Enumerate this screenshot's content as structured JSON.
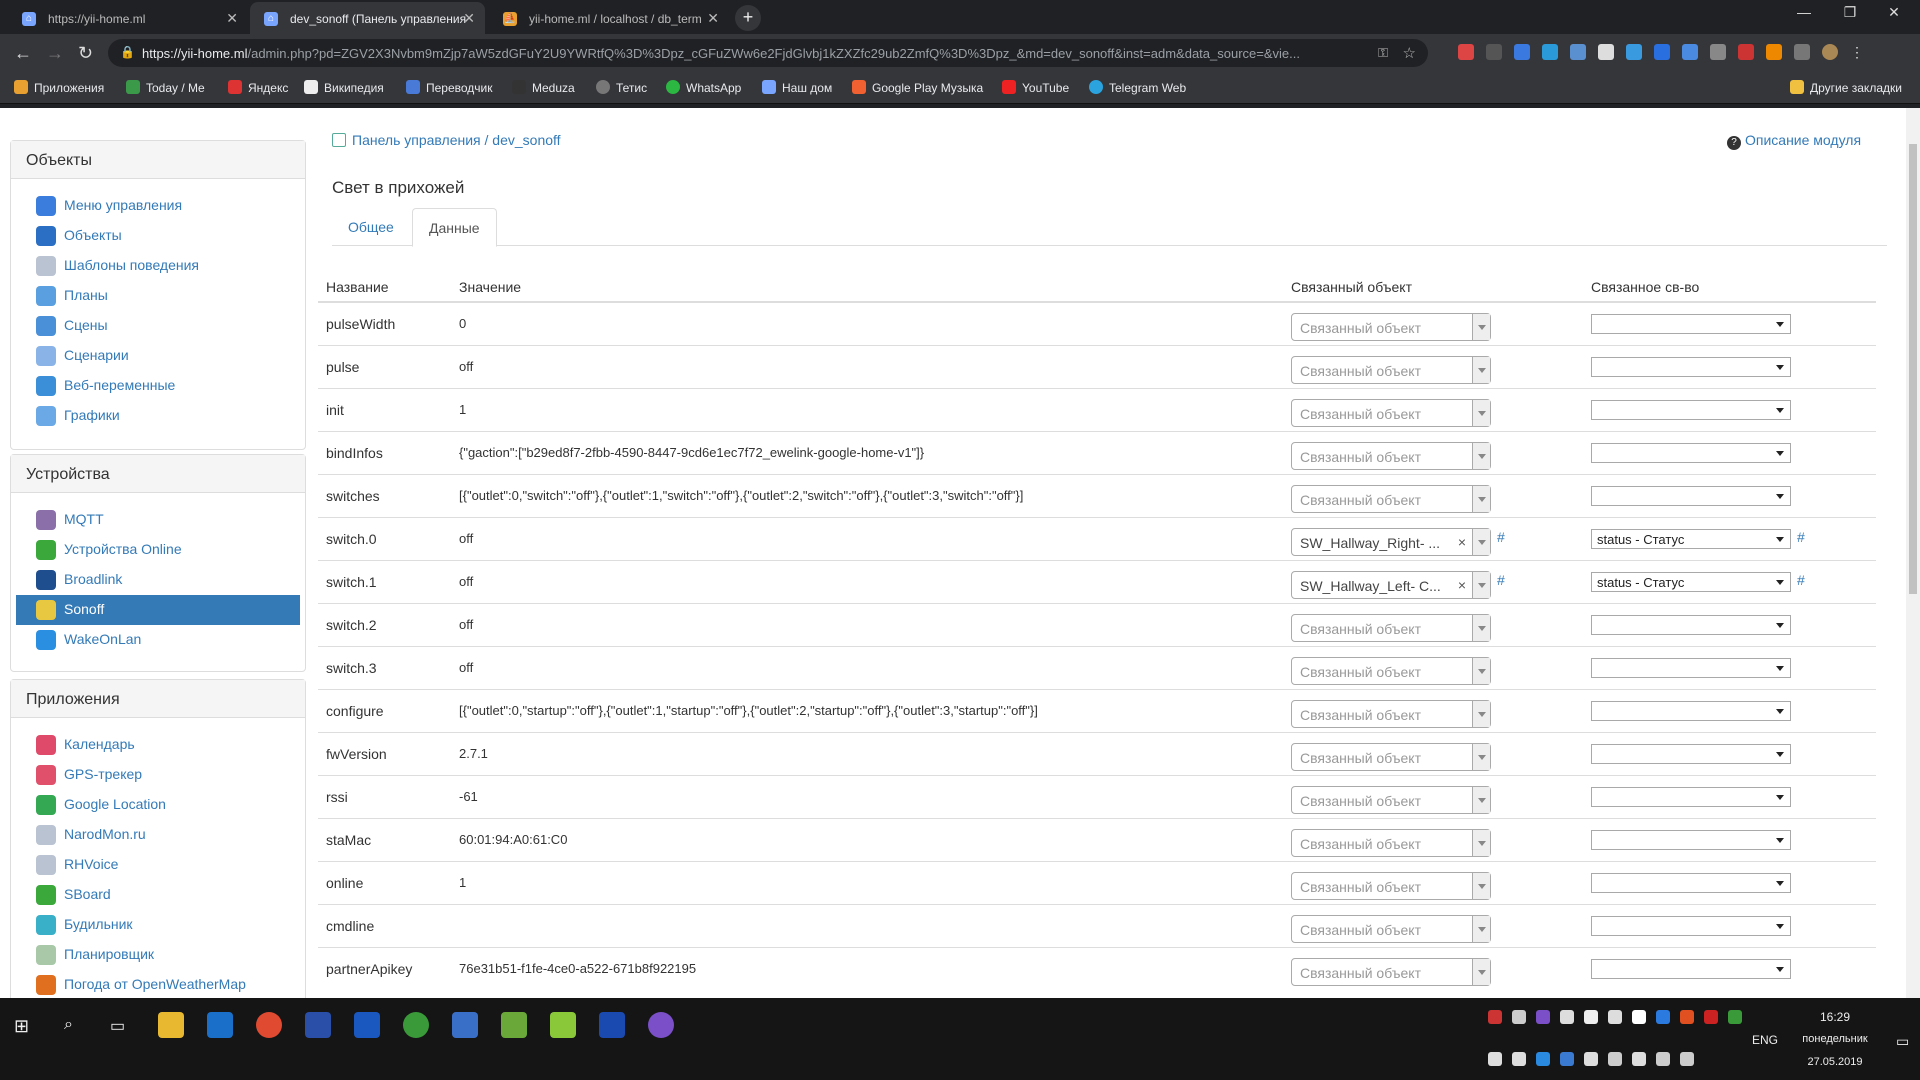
{
  "browser": {
    "tabs": [
      {
        "title": "https://yii-home.ml"
      },
      {
        "title": "dev_sonoff (Панель управления"
      },
      {
        "title": "yii-home.ml / localhost / db_term"
      }
    ],
    "url_host": "https://yii-home.ml",
    "url_path": "/admin.php?pd=ZGV2X3Nvbm9mZjp7aW5zdGFuY2U9YWRtfQ%3D%3Dpz_cGFuZWw6e2FjdGlvbj1kZXZfc29ub2ZmfQ%3D%3Dpz_&md=dev_sonoff&inst=adm&data_source=&vie...",
    "bookmarks": [
      "Приложения",
      "Today / Me",
      "Яндекс",
      "Википедия",
      "Переводчик",
      "Meduza",
      "Тетис",
      "WhatsApp",
      "Наш дом",
      "Google Play Музыка",
      "YouTube",
      "Telegram Web"
    ],
    "other_bookmarks": "Другие закладки",
    "colors": {
      "chrome_dark": "#202124",
      "chrome_mid": "#35363a",
      "link": "#337ab7",
      "active": "#337ab7"
    }
  },
  "sidebar": {
    "objects": {
      "title": "Объекты",
      "items": [
        {
          "label": "Меню управления",
          "icon": "menu-icon",
          "color": "#3b7ddd"
        },
        {
          "label": "Объекты",
          "icon": "globe-icon",
          "color": "#2a6fc4"
        },
        {
          "label": "Шаблоны поведения",
          "icon": "template-icon",
          "color": "#b9c3d1"
        },
        {
          "label": "Планы",
          "icon": "plans-icon",
          "color": "#5aa0e0"
        },
        {
          "label": "Сцены",
          "icon": "scenes-icon",
          "color": "#4a90d9"
        },
        {
          "label": "Сценарии",
          "icon": "scripts-icon",
          "color": "#8ab4e8"
        },
        {
          "label": "Веб-переменные",
          "icon": "web-vars-icon",
          "color": "#3a8fd8"
        },
        {
          "label": "Графики",
          "icon": "charts-icon",
          "color": "#6aa8e6"
        }
      ]
    },
    "devices": {
      "title": "Устройства",
      "items": [
        {
          "label": "MQTT",
          "icon": "mqtt-icon",
          "color": "#8a6fa8"
        },
        {
          "label": "Устройства Online",
          "icon": "online-icon",
          "color": "#3aa83a"
        },
        {
          "label": "Broadlink",
          "icon": "broadlink-icon",
          "color": "#1f4e8f"
        },
        {
          "label": "Sonoff",
          "icon": "sonoff-icon",
          "color": "#e8c840",
          "active": true
        },
        {
          "label": "WakeOnLan",
          "icon": "power-icon",
          "color": "#2a8fe0"
        }
      ]
    },
    "apps": {
      "title": "Приложения",
      "items": [
        {
          "label": "Календарь",
          "icon": "calendar-icon",
          "color": "#e04a6a"
        },
        {
          "label": "GPS-трекер",
          "icon": "gps-icon",
          "color": "#e0506a"
        },
        {
          "label": "Google Location",
          "icon": "maps-icon",
          "color": "#34a853"
        },
        {
          "label": "NarodMon.ru",
          "icon": "narodmon-icon",
          "color": "#b9c3d1"
        },
        {
          "label": "RHVoice",
          "icon": "rhvoice-icon",
          "color": "#b9c3d1"
        },
        {
          "label": "SBoard",
          "icon": "sboard-icon",
          "color": "#3aa83a"
        },
        {
          "label": "Будильник",
          "icon": "alarm-icon",
          "color": "#3ab0c8"
        },
        {
          "label": "Планировщик",
          "icon": "scheduler-icon",
          "color": "#a8c8a8"
        },
        {
          "label": "Погода от OpenWeatherMap",
          "icon": "weather-icon",
          "color": "#e07020"
        }
      ]
    }
  },
  "main": {
    "breadcrumb_root": "Панель управления",
    "breadcrumb_sep": " / ",
    "breadcrumb_current": "dev_sonoff",
    "module_link": "Описание модуля",
    "title": "Свет в прихожей",
    "tabs": [
      {
        "label": "Общее"
      },
      {
        "label": "Данные",
        "active": true
      }
    ],
    "table": {
      "headers": [
        "Название",
        "Значение",
        "Связанный объект",
        "Связанное св-во"
      ],
      "placeholder": "Связанный объект",
      "rows": [
        {
          "name": "pulseWidth",
          "value": "0"
        },
        {
          "name": "pulse",
          "value": "off"
        },
        {
          "name": "init",
          "value": "1"
        },
        {
          "name": "bindInfos",
          "value": "{\"gaction\":[\"b29ed8f7-2fbb-4590-8447-9cd6e1ec7f72_ewelink-google-home-v1\"]}"
        },
        {
          "name": "switches",
          "value": "[{\"outlet\":0,\"switch\":\"off\"},{\"outlet\":1,\"switch\":\"off\"},{\"outlet\":2,\"switch\":\"off\"},{\"outlet\":3,\"switch\":\"off\"}]"
        },
        {
          "name": "switch.0",
          "value": "off",
          "linked_object": "SW_Hallway_Right- ...",
          "linked_prop": "status - Статус"
        },
        {
          "name": "switch.1",
          "value": "off",
          "linked_object": "SW_Hallway_Left- C...",
          "linked_prop": "status - Статус"
        },
        {
          "name": "switch.2",
          "value": "off"
        },
        {
          "name": "switch.3",
          "value": "off"
        },
        {
          "name": "configure",
          "value": "[{\"outlet\":0,\"startup\":\"off\"},{\"outlet\":1,\"startup\":\"off\"},{\"outlet\":2,\"startup\":\"off\"},{\"outlet\":3,\"startup\":\"off\"}]"
        },
        {
          "name": "fwVersion",
          "value": "2.7.1"
        },
        {
          "name": "rssi",
          "value": "-61"
        },
        {
          "name": "staMac",
          "value": "60:01:94:A0:61:C0"
        },
        {
          "name": "online",
          "value": "1"
        },
        {
          "name": "cmdline",
          "value": ""
        },
        {
          "name": "partnerApikey",
          "value": "76e31b51-f1fe-4ce0-a522-671b8f922195"
        }
      ]
    }
  },
  "taskbar": {
    "lang": "ENG",
    "time": "16:29",
    "day": "понедельник",
    "date": "27.05.2019"
  }
}
